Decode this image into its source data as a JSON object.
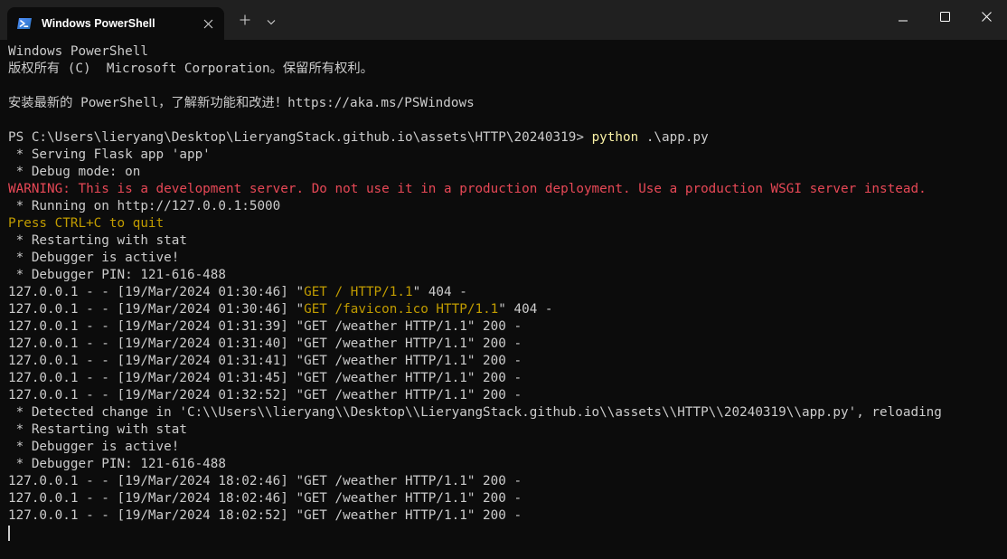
{
  "window": {
    "tab_title": "Windows PowerShell",
    "icons": {
      "tab": "powershell-icon",
      "close_tab": "close-icon",
      "new_tab": "plus-icon",
      "dropdown": "chevron-down-icon",
      "minimize": "minimize-icon",
      "maximize": "maximize-icon",
      "close_window": "close-icon"
    }
  },
  "terminal": {
    "header_line1": "Windows PowerShell",
    "header_line2": "版权所有 (C)  Microsoft Corporation。保留所有权利。",
    "header_line3": "安装最新的 PowerShell，了解新功能和改进！https://aka.ms/PSWindows",
    "prompt": "PS C:\\Users\\lieryang\\Desktop\\LieryangStack.github.io\\assets\\HTTP\\20240319> ",
    "command": "python",
    "command_args": " .\\app.py",
    "serving": " * Serving Flask app 'app'",
    "debug_mode": " * Debug mode: on",
    "warning": "WARNING: This is a development server. Do not use it in a production deployment. Use a production WSGI server instead.",
    "running": " * Running on http://127.0.0.1:5000",
    "quit": "Press CTRL+C to quit",
    "restart1": " * Restarting with stat",
    "debugger_active1": " * Debugger is active!",
    "debugger_pin1": " * Debugger PIN: 121-616-488",
    "log1_prefix": "127.0.0.1 - - [19/Mar/2024 01:30:46] \"",
    "log1_request": "GET / HTTP/1.1",
    "log1_suffix": "\" 404 -",
    "log2_prefix": "127.0.0.1 - - [19/Mar/2024 01:30:46] \"",
    "log2_request": "GET /favicon.ico HTTP/1.1",
    "log2_suffix": "\" 404 -",
    "log3": "127.0.0.1 - - [19/Mar/2024 01:31:39] \"GET /weather HTTP/1.1\" 200 -",
    "log4": "127.0.0.1 - - [19/Mar/2024 01:31:40] \"GET /weather HTTP/1.1\" 200 -",
    "log5": "127.0.0.1 - - [19/Mar/2024 01:31:41] \"GET /weather HTTP/1.1\" 200 -",
    "log6": "127.0.0.1 - - [19/Mar/2024 01:31:45] \"GET /weather HTTP/1.1\" 200 -",
    "log7": "127.0.0.1 - - [19/Mar/2024 01:32:52] \"GET /weather HTTP/1.1\" 200 -",
    "detected": " * Detected change in 'C:\\\\Users\\\\lieryang\\\\Desktop\\\\LieryangStack.github.io\\\\assets\\\\HTTP\\\\20240319\\\\app.py', reloading",
    "restart2": " * Restarting with stat",
    "debugger_active2": " * Debugger is active!",
    "debugger_pin2": " * Debugger PIN: 121-616-488",
    "log8": "127.0.0.1 - - [19/Mar/2024 18:02:46] \"GET /weather HTTP/1.1\" 200 -",
    "log9": "127.0.0.1 - - [19/Mar/2024 18:02:46] \"GET /weather HTTP/1.1\" 200 -",
    "log10": "127.0.0.1 - - [19/Mar/2024 18:02:52] \"GET /weather HTTP/1.1\" 200 -"
  },
  "colors": {
    "background": "#0c0c0c",
    "titlebar": "#202020",
    "text": "#cccccc",
    "warning_red": "#e74856",
    "highlight_yellow": "#c19c00",
    "command_yellow": "#f9f1a5"
  }
}
